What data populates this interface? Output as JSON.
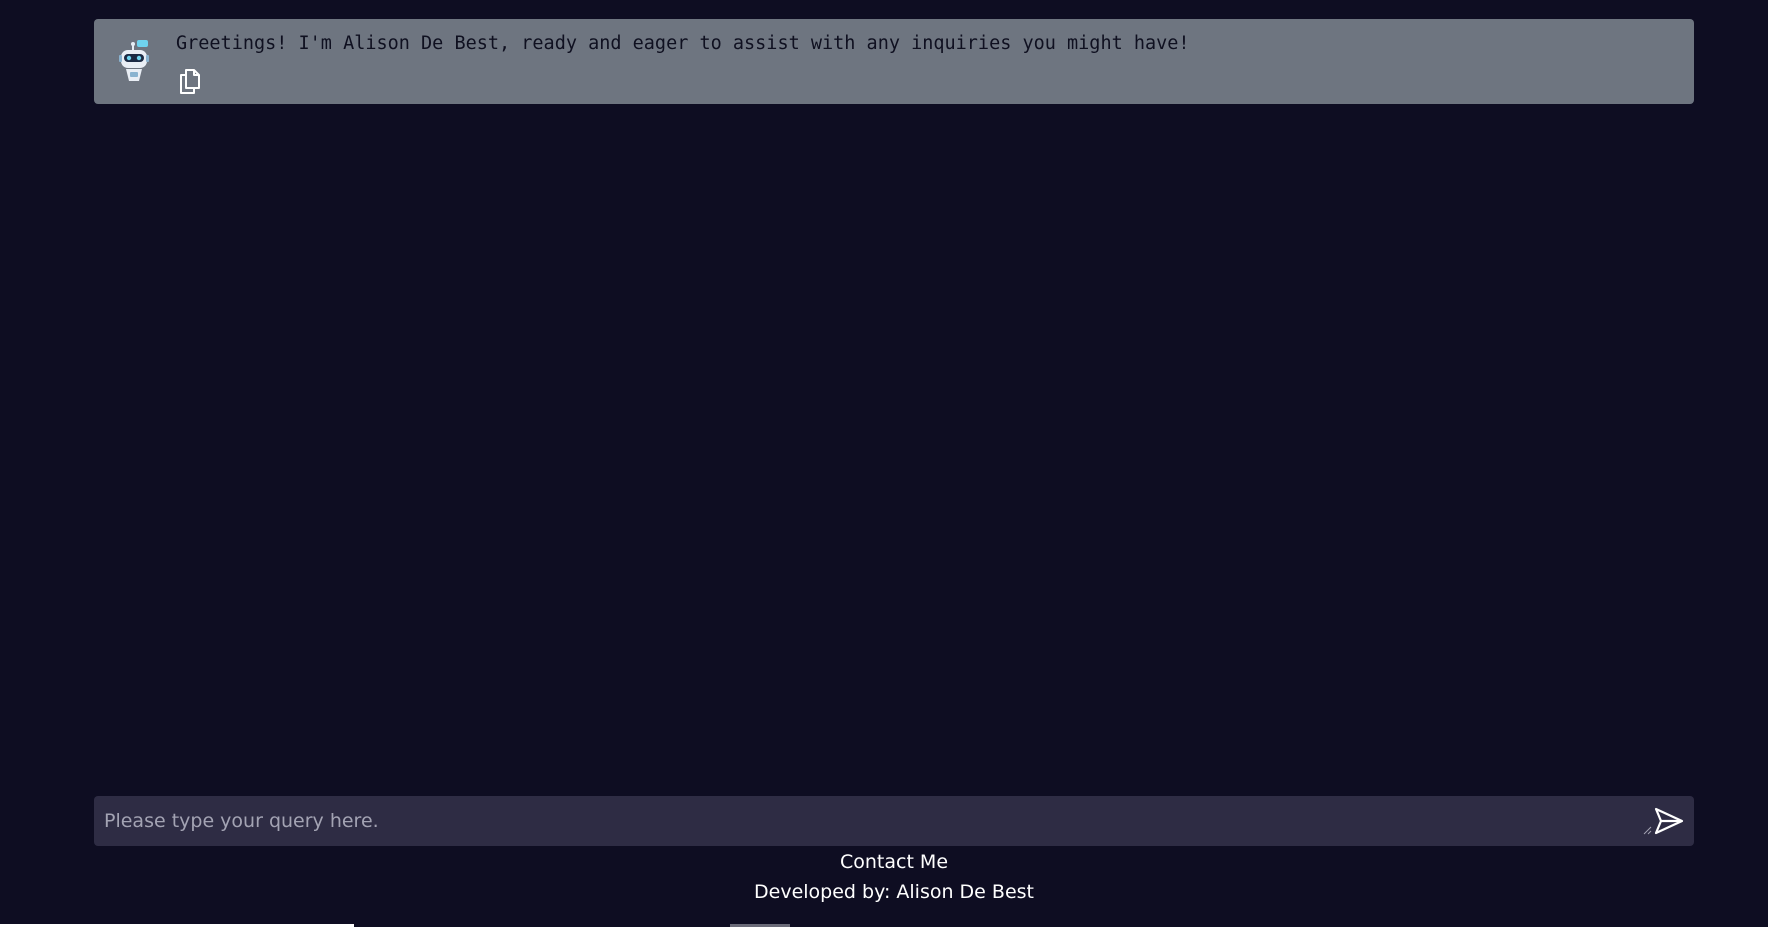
{
  "chat": {
    "messages": [
      {
        "sender": "bot",
        "avatar_icon": "robot-icon",
        "text": "Greetings! I'm Alison De Best, ready and eager to assist with any inquiries you might have!",
        "copy_icon": "copy-icon"
      }
    ]
  },
  "composer": {
    "placeholder": "Please type your query here.",
    "value": "",
    "send_icon": "send-icon"
  },
  "footer": {
    "contact_label": "Contact Me",
    "credit": "Developed by: Alison De Best"
  },
  "colors": {
    "background": "#0e0d22",
    "message_card": "#6e7580",
    "composer": "#2e2c44",
    "text_light": "#ffffff"
  }
}
